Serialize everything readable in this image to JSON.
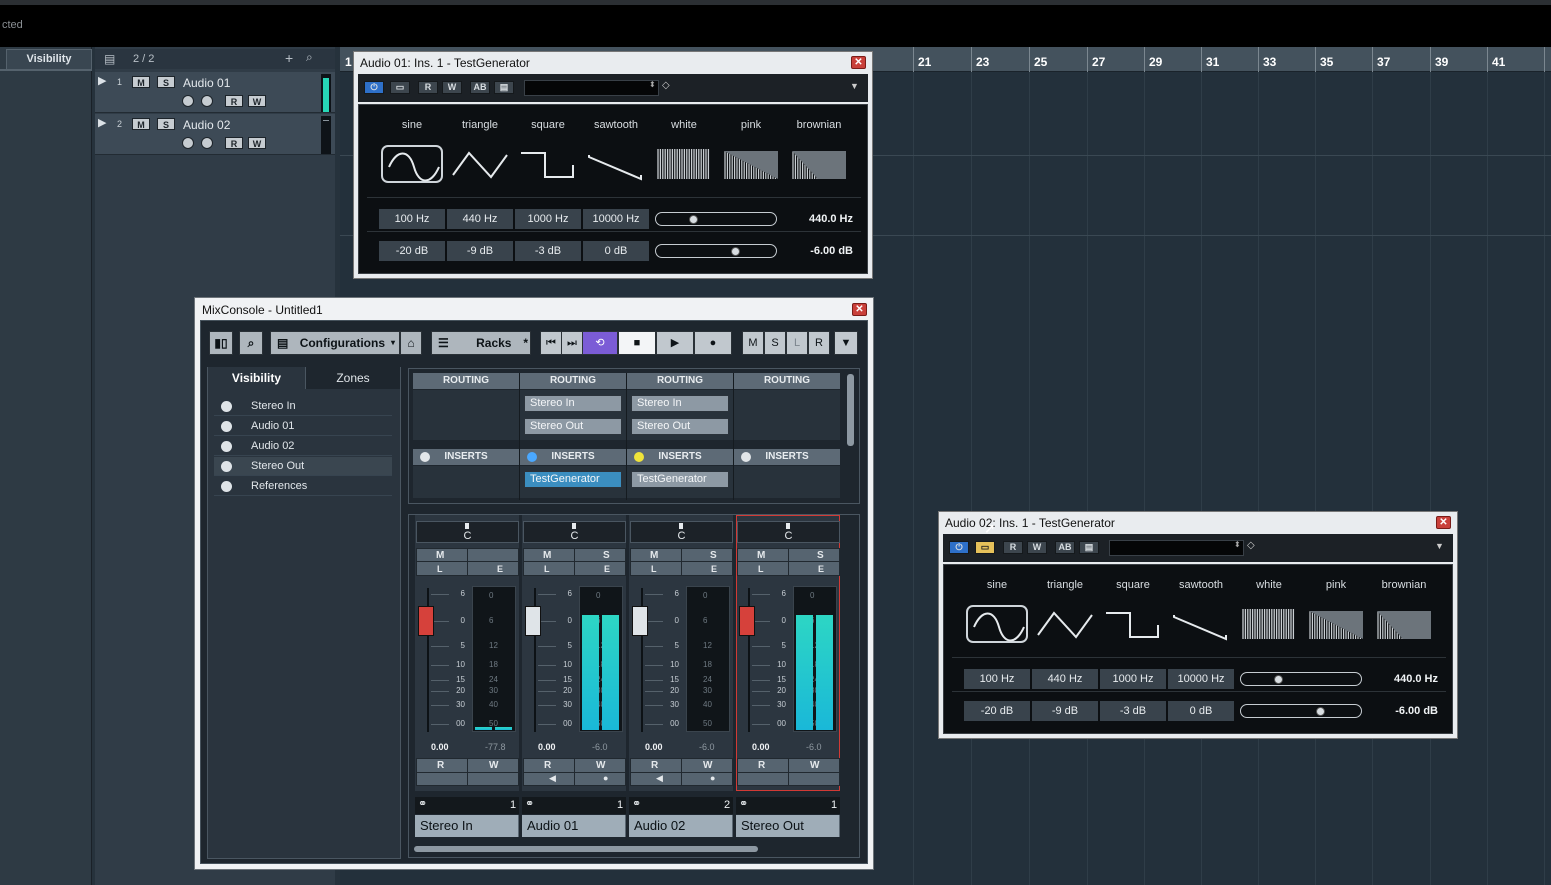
{
  "status": {
    "text": "cted"
  },
  "left_tab": {
    "label": "Visibility"
  },
  "tracklist": {
    "count": "2 / 2",
    "tracks": [
      {
        "num": "1",
        "name": "Audio 01",
        "m": "M",
        "s": "S",
        "r": "R",
        "w": "W"
      },
      {
        "num": "2",
        "name": "Audio 02",
        "m": "M",
        "s": "S",
        "r": "R",
        "w": "W"
      }
    ]
  },
  "ruler": {
    "first": "1",
    "bars": [
      "21",
      "23",
      "25",
      "27",
      "29",
      "31",
      "33",
      "35",
      "37",
      "39",
      "41"
    ]
  },
  "tg1": {
    "title": "Audio 01: Ins. 1 - TestGenerator",
    "waves": [
      "sine",
      "triangle",
      "square",
      "sawtooth",
      "white",
      "pink",
      "brownian"
    ],
    "freqs": [
      "100 Hz",
      "440 Hz",
      "1000 Hz",
      "10000 Hz"
    ],
    "levels": [
      "-20 dB",
      "-9 dB",
      "-3 dB",
      "0 dB"
    ],
    "freq_readout": "440.0 Hz",
    "level_readout": "-6.00 dB",
    "freq_slider_fraction": 0.3,
    "level_slider_fraction": 0.68,
    "btn_r": "R",
    "btn_w": "W"
  },
  "tg2": {
    "title": "Audio 02: Ins. 1 - TestGenerator",
    "waves": [
      "sine",
      "triangle",
      "square",
      "sawtooth",
      "white",
      "pink",
      "brownian"
    ],
    "freqs": [
      "100 Hz",
      "440 Hz",
      "1000 Hz",
      "10000 Hz"
    ],
    "levels": [
      "-20 dB",
      "-9 dB",
      "-3 dB",
      "0 dB"
    ],
    "freq_readout": "440.0 Hz",
    "level_readout": "-6.00 dB",
    "freq_slider_fraction": 0.3,
    "level_slider_fraction": 0.68,
    "btn_r": "R",
    "btn_w": "W"
  },
  "mix": {
    "title": "MixConsole - Untitled1",
    "configurations": "Configurations",
    "racks": "Racks",
    "star": "*",
    "transport_labels": [
      "M",
      "S",
      "L",
      "R"
    ],
    "visibility_tab": "Visibility",
    "zones_tab": "Zones",
    "vis_items": [
      "Stereo In",
      "Audio 01",
      "Audio 02",
      "Stereo Out",
      "References"
    ],
    "routing_header": "ROUTING",
    "inserts_header": "INSERTS",
    "routing": [
      {
        "in": "",
        "out": ""
      },
      {
        "in": "Stereo In",
        "out": "Stereo Out"
      },
      {
        "in": "Stereo In",
        "out": "Stereo Out"
      },
      {
        "in": "",
        "out": ""
      }
    ],
    "inserts": [
      "",
      "TestGenerator",
      "TestGenerator",
      ""
    ],
    "channels": [
      {
        "name": "Stereo In",
        "pan": "C",
        "vol": "0.00",
        "peak": "-77.8",
        "num": "1",
        "meter": 0.02,
        "fader_color": "#d6413b",
        "m": "M",
        "l": "L",
        "s": "",
        "e": "E"
      },
      {
        "name": "Audio 01",
        "pan": "C",
        "vol": "0.00",
        "peak": "-6.0",
        "num": "1",
        "meter": 0.82,
        "fader_color": "#dfe4e8",
        "m": "M",
        "l": "L",
        "s": "S",
        "e": "E"
      },
      {
        "name": "Audio 02",
        "pan": "C",
        "vol": "0.00",
        "peak": "-6.0",
        "num": "2",
        "meter": 0.0,
        "fader_color": "#dfe4e8",
        "m": "M",
        "l": "L",
        "s": "S",
        "e": "E"
      },
      {
        "name": "Stereo Out",
        "pan": "C",
        "vol": "0.00",
        "peak": "-6.0",
        "num": "1",
        "meter": 0.82,
        "fader_color": "#d6413b",
        "m": "M",
        "l": "L",
        "s": "S",
        "e": "E"
      }
    ],
    "rw": {
      "r": "R",
      "w": "W"
    },
    "scale_left": [
      "6",
      "0",
      "5",
      "10",
      "15",
      "20",
      "30",
      "00"
    ],
    "scale_meter": [
      "0",
      "6",
      "12",
      "18",
      "24",
      "30",
      "40",
      "50"
    ]
  }
}
